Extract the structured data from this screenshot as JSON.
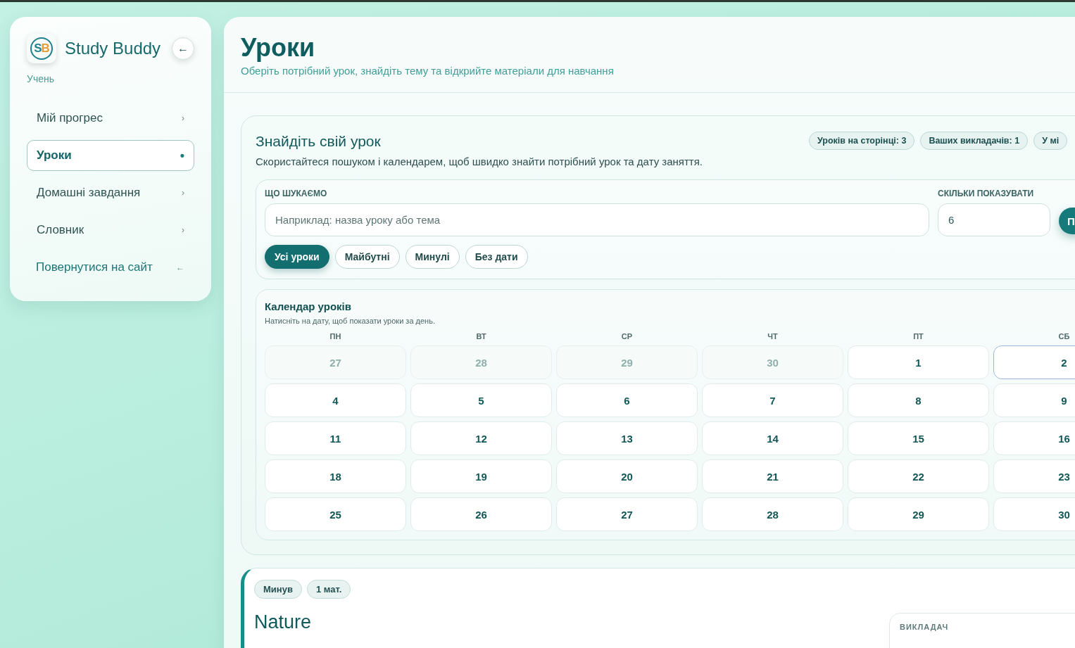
{
  "sidebar": {
    "logo": "SB",
    "brand": "Study Buddy",
    "collapse_icon": "←",
    "role": "Учень",
    "items": [
      {
        "label": "Мій прогрес",
        "icon": "›",
        "kind": "nav",
        "selected": false
      },
      {
        "label": "Уроки",
        "icon": "•",
        "kind": "nav",
        "selected": true
      },
      {
        "label": "Домашні завдання",
        "icon": "›",
        "kind": "nav",
        "selected": false
      },
      {
        "label": "Словник",
        "icon": "›",
        "kind": "nav",
        "selected": false
      },
      {
        "label": "Повернутися на сайт",
        "icon": "←",
        "kind": "link",
        "selected": false
      }
    ]
  },
  "page": {
    "title": "Уроки",
    "subtitle": "Оберіть потрібний урок, знайдіть тему та відкрийте матеріали для навчання"
  },
  "finder": {
    "title": "Знайдіть свій урок",
    "description": "Скористайтеся пошуком і календарем, щоб швидко знайти потрібний урок та дату заняття.",
    "stats": [
      "Уроків на сторінці: 3",
      "Ваших викладачів: 1",
      "У мі"
    ],
    "search": {
      "label": "ЩО ШУКАЄМО",
      "placeholder": "Наприклад: назва уроку або тема"
    },
    "count": {
      "label": "СКІЛЬКИ ПОКАЗУВАТИ",
      "value": "6"
    },
    "submit": "П",
    "filters": [
      {
        "label": "Усі уроки",
        "selected": true
      },
      {
        "label": "Майбутні",
        "selected": false
      },
      {
        "label": "Минулі",
        "selected": false
      },
      {
        "label": "Без дати",
        "selected": false
      }
    ]
  },
  "calendar": {
    "title": "Календар уроків",
    "hint": "Натисніть на дату, щоб показати уроки за день.",
    "weekdays": [
      "ПН",
      "ВТ",
      "СР",
      "ЧТ",
      "ПТ",
      "СБ"
    ],
    "weeks": [
      [
        {
          "day": "27",
          "outside": true,
          "today": false
        },
        {
          "day": "28",
          "outside": true,
          "today": false
        },
        {
          "day": "29",
          "outside": true,
          "today": false
        },
        {
          "day": "30",
          "outside": true,
          "today": false
        },
        {
          "day": "1",
          "outside": false,
          "today": false
        },
        {
          "day": "2",
          "outside": false,
          "today": true
        }
      ],
      [
        {
          "day": "4",
          "outside": false,
          "today": false
        },
        {
          "day": "5",
          "outside": false,
          "today": false
        },
        {
          "day": "6",
          "outside": false,
          "today": false
        },
        {
          "day": "7",
          "outside": false,
          "today": false
        },
        {
          "day": "8",
          "outside": false,
          "today": false
        },
        {
          "day": "9",
          "outside": false,
          "today": false
        }
      ],
      [
        {
          "day": "11",
          "outside": false,
          "today": false
        },
        {
          "day": "12",
          "outside": false,
          "today": false
        },
        {
          "day": "13",
          "outside": false,
          "today": false
        },
        {
          "day": "14",
          "outside": false,
          "today": false
        },
        {
          "day": "15",
          "outside": false,
          "today": false
        },
        {
          "day": "16",
          "outside": false,
          "today": false
        }
      ],
      [
        {
          "day": "18",
          "outside": false,
          "today": false
        },
        {
          "day": "19",
          "outside": false,
          "today": false
        },
        {
          "day": "20",
          "outside": false,
          "today": false
        },
        {
          "day": "21",
          "outside": false,
          "today": false
        },
        {
          "day": "22",
          "outside": false,
          "today": false
        },
        {
          "day": "23",
          "outside": false,
          "today": false
        }
      ],
      [
        {
          "day": "25",
          "outside": false,
          "today": false
        },
        {
          "day": "26",
          "outside": false,
          "today": false
        },
        {
          "day": "27",
          "outside": false,
          "today": false
        },
        {
          "day": "28",
          "outside": false,
          "today": false
        },
        {
          "day": "29",
          "outside": false,
          "today": false
        },
        {
          "day": "30",
          "outside": false,
          "today": false
        }
      ]
    ]
  },
  "lesson": {
    "tags": [
      "Минув",
      "1 мат."
    ],
    "title": "Nature",
    "teacher_label": "ВИКЛАДАЧ"
  }
}
